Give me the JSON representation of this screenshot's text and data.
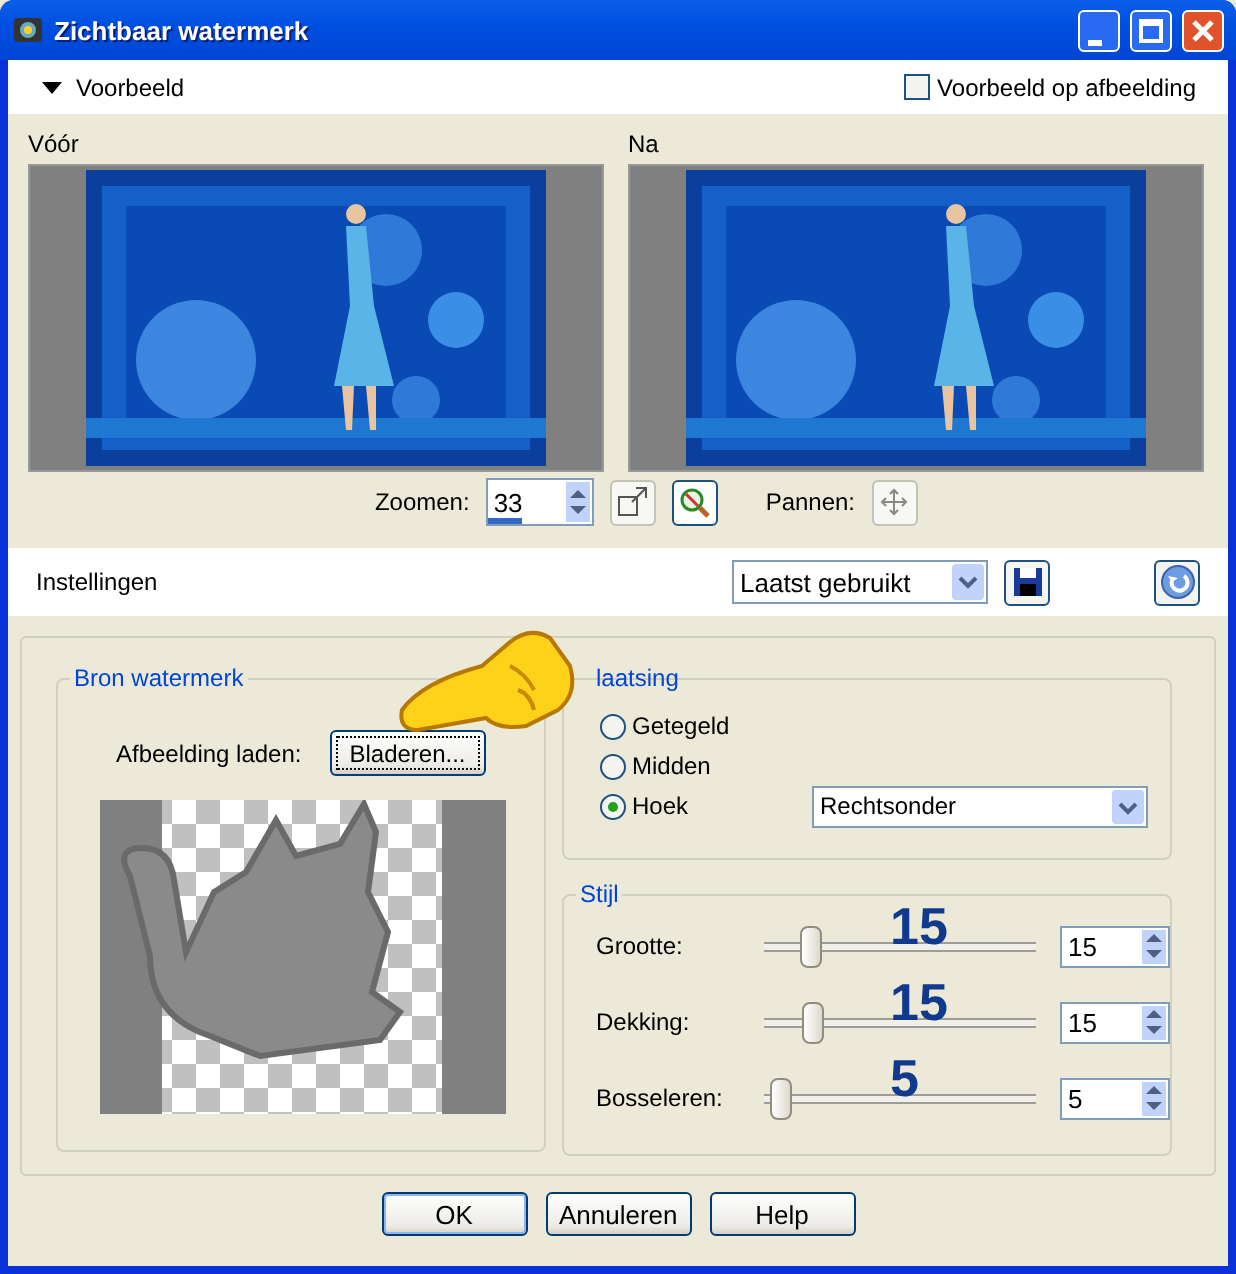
{
  "window": {
    "title": "Zichtbaar watermerk"
  },
  "preview_bar": {
    "toggle": "Voorbeeld",
    "expanded": true,
    "preview_on_image": {
      "label": "Voorbeeld op afbeelding",
      "checked": false
    }
  },
  "previews": [
    {
      "label": "Vóór",
      "kind": "picture"
    },
    {
      "label": "Na",
      "kind": "picture"
    }
  ],
  "zoom": {
    "label": "Zoomen:",
    "value": "33",
    "level": 0.33
  },
  "pan": {
    "label": "Pannen:"
  },
  "settings_bar": {
    "label": "Instellingen",
    "preset": "Laatst gebruikt"
  },
  "source": {
    "title": "Bron watermerk",
    "load_label": "Afbeelding laden:",
    "browse_button": "Bladeren..."
  },
  "placement": {
    "title": "laatsing",
    "corner": "Rechtsonder",
    "options": [
      {
        "label": "Getegeld",
        "selected": false
      },
      {
        "label": "Midden",
        "selected": false
      },
      {
        "label": "Hoek",
        "selected": true
      }
    ]
  },
  "style": {
    "title": "Stijl",
    "sliders": [
      {
        "label": "Grootte:",
        "level": 0.17,
        "value": "15",
        "annotation": "15"
      },
      {
        "label": "Dekking:",
        "level": 0.18,
        "value": "15",
        "annotation": "15"
      },
      {
        "label": "Bosseleren:",
        "level": 0.06,
        "value": "5",
        "annotation": "5"
      }
    ]
  },
  "buttons": [
    "OK",
    "Annuleren",
    "Help"
  ]
}
